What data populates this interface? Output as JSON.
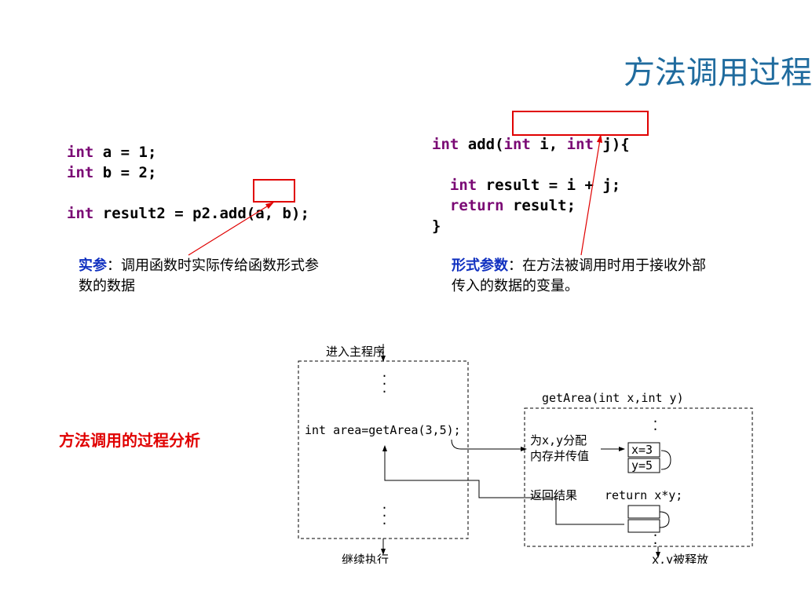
{
  "title": "方法调用过程",
  "left_code": {
    "l1_kw": "int",
    "l1_rest": " a = 1;",
    "l2_kw": "int",
    "l2_rest": " b = 2;",
    "l3_kw": "int",
    "l3_rest1": " result2 = p2.add(",
    "l3_args": "a, b",
    "l3_rest2": ");"
  },
  "right_code": {
    "l1_kw": "int",
    "l1_mid": " add(",
    "l1_p1kw": "int",
    "l1_p1": " i, ",
    "l1_p2kw": "int",
    "l1_p2": " j",
    "l1_close": "){",
    "l2_kw": "int",
    "l2_rest": " result = i + j;",
    "l3_kw": "return",
    "l3_rest": " result;",
    "l4": "}"
  },
  "left_annot": {
    "label": "实参",
    "text": "：调用函数时实际传给函数形式参数的数据"
  },
  "right_annot": {
    "label": "形式参数",
    "text": "：在方法被调用时用于接收外部传入的数据的变量。"
  },
  "heading": "方法调用的过程分析",
  "diagram": {
    "enter_main": "进入主程序",
    "call_line": "int area=getArea(3,5);",
    "continue": "继续执行",
    "func_sig": "getArea(int x,int y)",
    "alloc1": "为x,y分配",
    "alloc2": "内存并传值",
    "x_eq": "x=3",
    "y_eq": "y=5",
    "return_expr": "return x*y;",
    "return_res": "返回结果",
    "release": "x,y被释放"
  }
}
